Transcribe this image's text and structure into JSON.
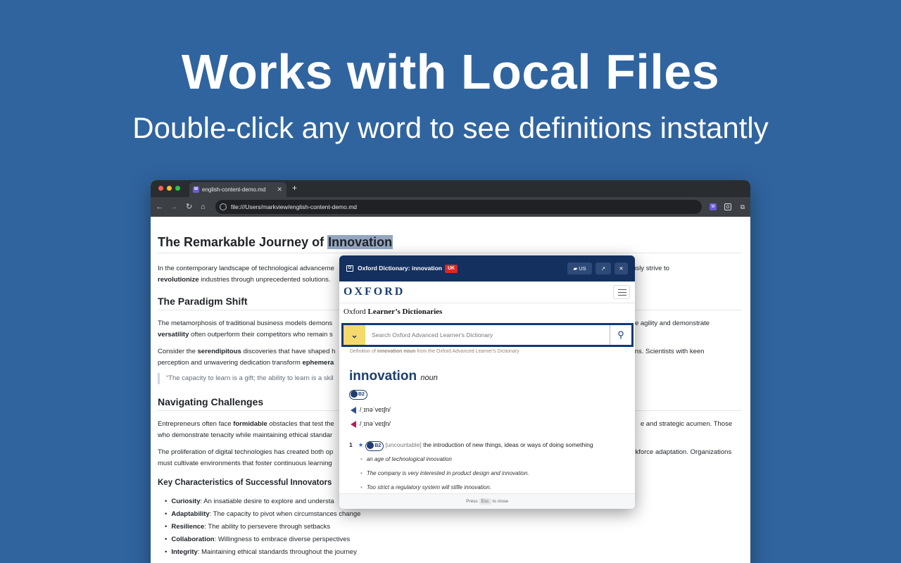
{
  "hero": {
    "title": "Works with Local Files",
    "subtitle": "Double-click any word to see definitions instantly"
  },
  "browser": {
    "tab_title": "english-content-demo.md",
    "tab_favicon": "M",
    "new_tab": "+",
    "url": "file:///Users/markview/english-content-demo.md",
    "window_dots": [
      "#ff5f57",
      "#febc2e",
      "#28c840"
    ]
  },
  "doc": {
    "h1_prefix": "The Remarkable Journey of ",
    "h1_highlight": "Innovation",
    "p1_start": "In the contemporary landscape of technological advanceme",
    "p1_end": "s continuously strive to",
    "p1_bold": "revolutionize",
    "p1_rest": " industries through unprecedented solutions.",
    "h2_paradigm": "The Paradigm Shift",
    "p2_start": "The metamorphosis of traditional business models demons",
    "p2_end": "ce agility and demonstrate",
    "p2_bold": "versatility",
    "p2_rest": " often outperform their competitors who remain s",
    "p3_start": "Consider the ",
    "p3_bold": "serendipitous",
    "p3_mid": " discoveries that have shaped h",
    "p3_end": "ons. Scientists with keen",
    "p3_line2": "perception and unwavering dedication transform ",
    "p3_bold2": "ephemera",
    "quote": "“The capacity to learn is a gift; the ability to learn is a skil",
    "h2_challenges": "Navigating Challenges",
    "p4_start": "Entrepreneurs often face ",
    "p4_bold": "formidable",
    "p4_mid": " obstacles that test the",
    "p4_end": "e and strategic acumen. Those",
    "p4_line2": "who demonstrate tenacity while maintaining ethical standar",
    "p5_start": "The proliferation of digital technologies has created both op",
    "p5_end": "rkforce adaptation. Organizations",
    "p5_line2": "must cultivate environments that foster continuous learning",
    "h3": "Key Characteristics of Successful Innovators",
    "items": [
      {
        "term": "Curiosity",
        "desc": ": An insatiable desire to explore and understa"
      },
      {
        "term": "Adaptability",
        "desc": ": The capacity to pivot when circumstances change"
      },
      {
        "term": "Resilience",
        "desc": ": The ability to persevere through setbacks"
      },
      {
        "term": "Collaboration",
        "desc": ": Willingness to embrace diverse perspectives"
      },
      {
        "term": "Integrity",
        "desc": ": Maintaining ethical standards throughout the journey"
      }
    ]
  },
  "popup": {
    "header_title": "Oxford Dictionary: innovation",
    "region_badge": "UK",
    "us_button": "US",
    "oxford_wordmark": "OXFORD",
    "site_title_a": "Oxford",
    "site_title_b": " Learner’s Dictionaries",
    "search_placeholder": "Search Oxford Advanced Learner's Dictionary",
    "def_note_a": "Definition of ",
    "def_note_b": "innovation noun",
    "def_note_c": " from the Oxford Advanced Learner's Dictionary",
    "headword": "innovation",
    "pos": "noun",
    "cefr": "B2",
    "phon_uk": "/ˌɪnəˈveɪʃn/",
    "phon_us": "/ˌɪnəˈveɪʃn/",
    "sense_num": "1",
    "grammar": "[uncountable]",
    "definition": "the introduction of new things, ideas or ways of doing something",
    "examples": [
      "an age of technological innovation",
      "The company is very interested in product design and innovation.",
      "Too strict a regulatory system will stifle innovation."
    ],
    "footer_a": "Press",
    "footer_key": "Esc",
    "footer_b": "to close",
    "brand_color": "#13305f",
    "accent_color": "#f5d96b"
  }
}
